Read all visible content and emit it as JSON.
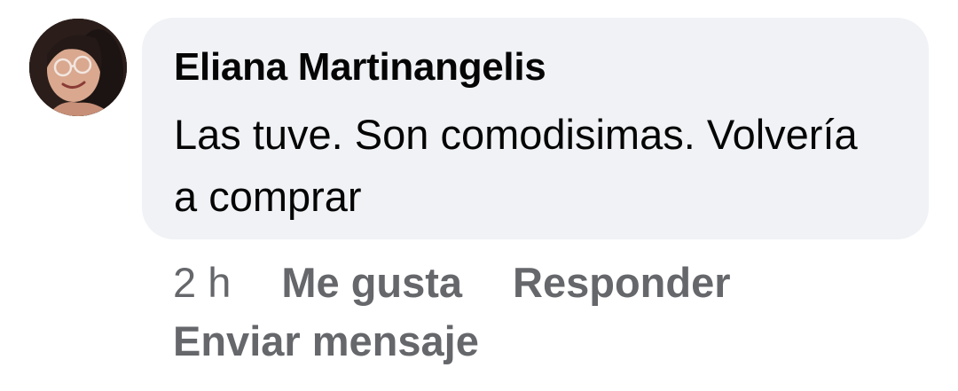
{
  "comment": {
    "author": "Eliana Martinangelis",
    "text": "Las tuve. Son comodisimas. Volvería a comprar",
    "avatar_icon": "user-photo-avatar"
  },
  "actions": {
    "time": "2 h",
    "like_label": "Me gusta",
    "reply_label": "Responder",
    "message_label": "Enviar mensaje"
  },
  "colors": {
    "bubble_background": "#f0f2f5",
    "text_primary": "#050505",
    "text_secondary": "#65676b"
  }
}
